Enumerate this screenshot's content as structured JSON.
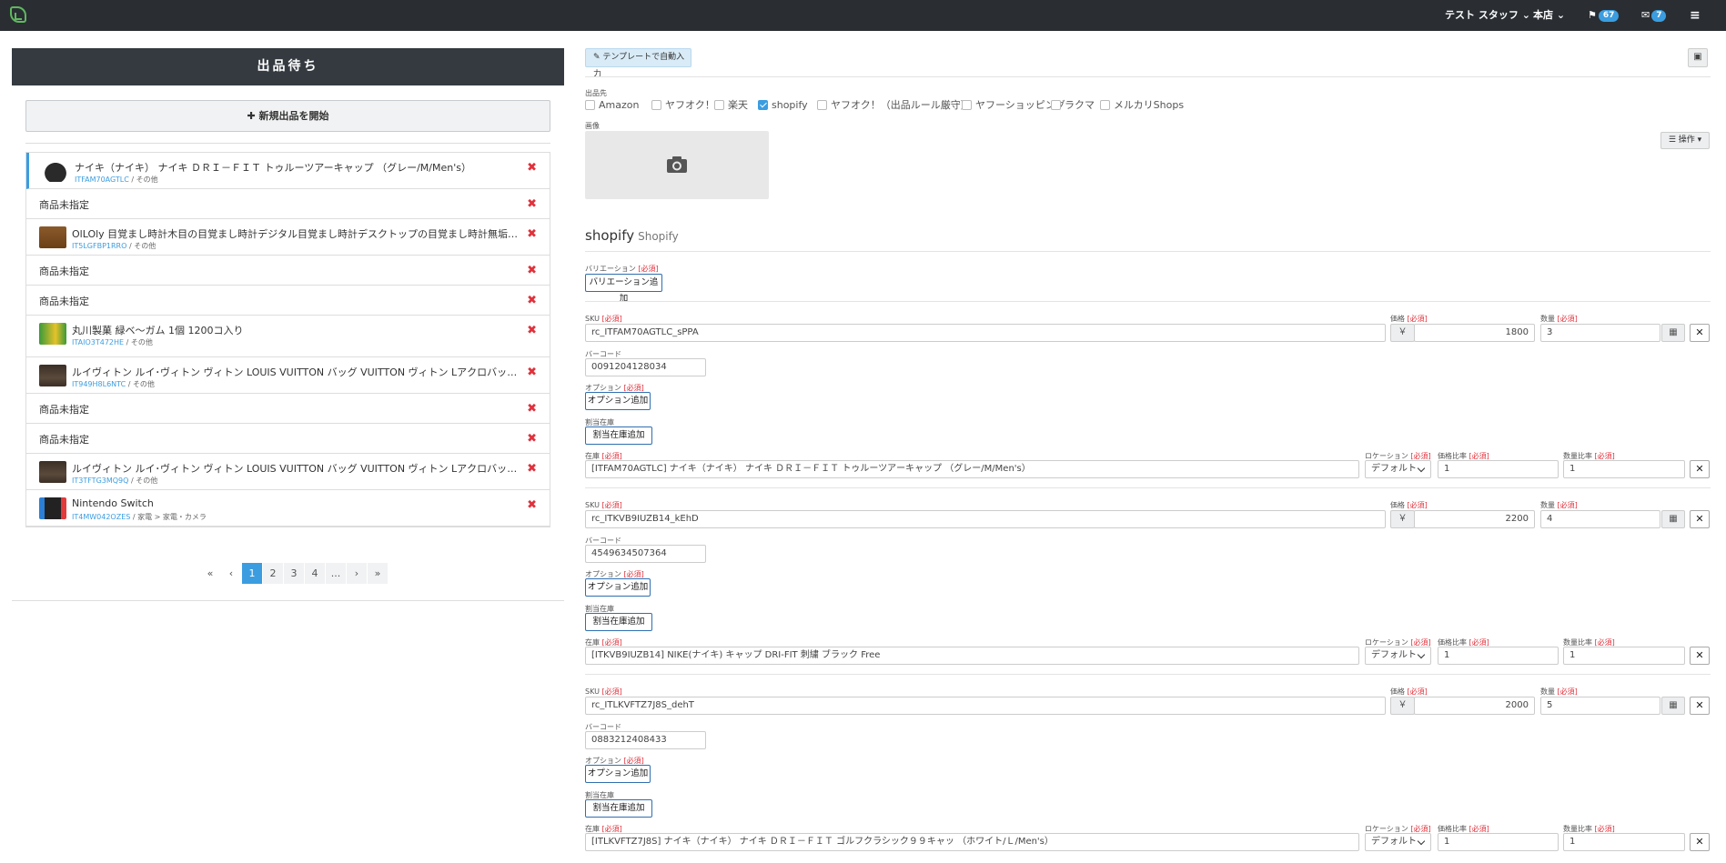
{
  "topbar": {
    "user_label": "テスト スタッフ",
    "store_label": "本店",
    "flag_count": "67",
    "chat_count": "7"
  },
  "left": {
    "header": "出品待ち",
    "new_button": "✚ 新規出品を開始",
    "items": [
      {
        "title": "ナイキ（ナイキ） ナイキ ＤＲＩ－ＦＩＴ トゥルーツアーキャップ （グレー/M/Men's）",
        "sku": "ITFAM70AGTLC",
        "category": " / その他",
        "thumb": "cap",
        "active": true
      },
      {
        "unset": "商品未指定"
      },
      {
        "title": "OlLOly 目覚まし時計木目の目覚まし時計デジタル目覚まし時計デスクトップの目覚まし時計無垢材の目覚まし時計...",
        "sku": "IT5LGFBP1RRO",
        "category": " / その他",
        "thumb": "clock"
      },
      {
        "unset": "商品未指定"
      },
      {
        "unset": "商品未指定"
      },
      {
        "title": "丸川製菓 緑ベ～ガム 1個 1200コ入り",
        "sku": "ITAIO3T472HE",
        "category": " / その他",
        "thumb": "gum"
      },
      {
        "title": "ルイヴィトン ルイ･ヴィトン ヴィトン LOUIS VUITTON バッグ VUITTON ヴィトン Lアクロバット ボディバッグ ダミエジエアン...",
        "sku": "IT949H8L6NTC",
        "category": " / その他",
        "thumb": "bag"
      },
      {
        "unset": "商品未指定"
      },
      {
        "unset": "商品未指定"
      },
      {
        "title": "ルイヴィトン ルイ･ヴィトン ヴィトン LOUIS VUITTON バッグ VUITTON ヴィトン Lアクロバット ボディバッグ ダミエジエアン...",
        "sku": "IT3TFTG3MQ9Q",
        "category": " / その他",
        "thumb": "bag"
      },
      {
        "title": "Nintendo Switch",
        "sku": "IT4MW042OZES",
        "category": " / 家電 > 家電・カメラ",
        "thumb": "switch"
      }
    ],
    "pagination": [
      "«",
      "‹",
      "1",
      "2",
      "3",
      "4",
      "...",
      "›",
      "»"
    ],
    "current_page": "1"
  },
  "right": {
    "template_button": "テンプレートで自動入力",
    "save_icon": "floppy-icon",
    "channels_label": "出品先",
    "channels": [
      {
        "label": "Amazon",
        "checked": false
      },
      {
        "label": "ヤフオク！",
        "checked": false
      },
      {
        "label": "楽天",
        "checked": false
      },
      {
        "label": "shopify",
        "checked": true
      },
      {
        "label": "ヤフオク！（出品ルール厳守）",
        "checked": false
      },
      {
        "label": "ヤフーショッピング",
        "checked": false
      },
      {
        "label": "ラクマ",
        "checked": false
      },
      {
        "label": "メルカリShops",
        "checked": false
      }
    ],
    "image_label": "画像",
    "ops_button": "☰ 操作 ▾",
    "section_title": "shopify",
    "section_sub": "Shopify",
    "variation_label": "バリエーション",
    "variation_button": "バリエーション追加",
    "req_tag": "[必須]",
    "labels": {
      "sku": "SKU",
      "price": "価格",
      "qty": "数量",
      "barcode": "バーコード",
      "option": "オプション",
      "alloc": "割当在庫",
      "stock": "在庫",
      "location": "ロケーション",
      "price_ratio": "価格比率",
      "qty_ratio": "数量比率"
    },
    "option_button": "オプション追加",
    "alloc_button": "割当在庫追加",
    "currency": "￥",
    "variants": [
      {
        "sku": "rc_ITFAM70AGTLC_sPPA",
        "price": "1800",
        "qty": "3",
        "barcode": "0091204128034",
        "stock": "[ITFAM70AGTLC] ナイキ（ナイキ） ナイキ ＤＲＩ－ＦＩＴ トゥルーツアーキャップ （グレー/M/Men's）",
        "location": "デフォルト",
        "price_ratio": "1",
        "qty_ratio": "1"
      },
      {
        "sku": "rc_ITKVB9IUZB14_kEhD",
        "price": "2200",
        "qty": "4",
        "barcode": "4549634507364",
        "stock": "[ITKVB9IUZB14] NIKE(ナイキ) キャップ DRI-FIT 刺繍 ブラック Free",
        "location": "デフォルト",
        "price_ratio": "1",
        "qty_ratio": "1"
      },
      {
        "sku": "rc_ITLKVFTZ7J8S_dehT",
        "price": "2000",
        "qty": "5",
        "barcode": "0883212408433",
        "stock": "[ITLKVFTZ7J8S] ナイキ（ナイキ） ナイキ ＤＲＩ－ＦＩＴ ゴルフクラシック９９キャッ （ホワイト/Ｌ/Men's）",
        "location": "デフォルト",
        "price_ratio": "1",
        "qty_ratio": "1"
      }
    ]
  }
}
